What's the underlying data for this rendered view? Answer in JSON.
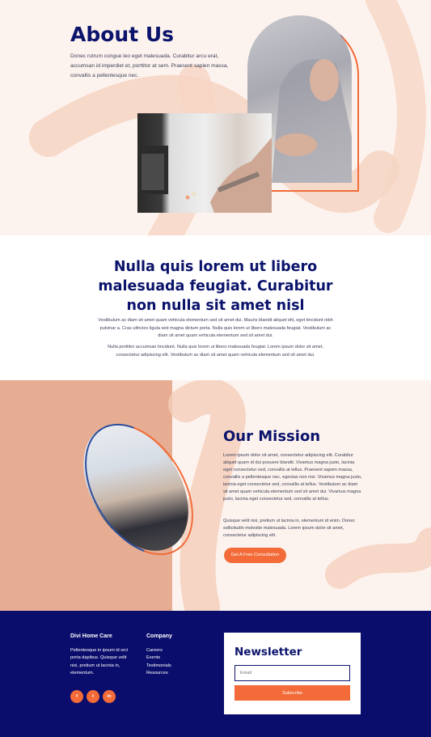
{
  "hero": {
    "title": "About Us",
    "text": "Donec rutrum congue leo eget malesuada. Curabitur arcu erat, accumsan id imperdiet et, porttitor at sem. Praesent sapien massa, convallis a pellentesque nec."
  },
  "intro": {
    "heading": "Nulla quis lorem ut libero malesuada feugiat. Curabitur non nulla sit amet nisl",
    "para1": "Vestibulum ac diam sit amet quam vehicula elementum sed sit amet dui. Mauris blandit aliquet elit, eget tincidunt nibh pulvinar a. Cras ultricies ligula sed magna dictum porta. Nulla quis lorem ut libero malesuada feugiat. Vestibulum ac diam sit amet quam vehicula elementum sed sit amet dui.",
    "para2": "Nulla porttitor accumsan tincidunt. Nulla quis lorem ut libero malesuada feugiat. Lorem ipsum dolor sit amet, consectetur adipiscing elit. Vestibulum ac diam sit amet quam vehicula elementum sed sit amet dui."
  },
  "mission": {
    "title": "Our Mission",
    "para1": "Lorem ipsum dolor sit amet, consectetur adipiscing elit. Curabitur aliquet quam id dui posuere blandit. Vivamus magna justo, lacinia eget consectetur sed, convallis at tellus. Praesent sapien massa, convallis a pellentesque nec, egestas non nisi. Vivamus magna justo, lacinia eget consectetur sed, convallis at tellus. Vestibulum ac diam sit amet quam vehicula elementum sed sit amet dui. Vivamus magna justo, lacinia eget consectetur sed, convallis at tellus.",
    "para2": "Quisque velit nisi, pretium ut lacinia in, elementum id enim. Donec sollicitudin molestie malesuada. Lorem ipsum dolor sit amet, consectetur adipiscing elit.",
    "cta": "Get A Free Consultation"
  },
  "footer": {
    "brand_title": "Divi Home Care",
    "brand_text": "Pellentesque in ipsum id orci porta dapibus. Quisque velit nisi, pretium ut lacinia in, elementum.",
    "company_title": "Company",
    "links": [
      "Careers",
      "Events",
      "Testimonials",
      "Resources"
    ],
    "social": [
      "f",
      "t",
      "in"
    ],
    "newsletter_title": "Newsletter",
    "email_placeholder": "Email",
    "subscribe_label": "Subscribe"
  },
  "colors": {
    "navy": "#0b136b",
    "accent": "#f26b38",
    "peach_bg": "#fdf3ee",
    "clay": "#e6ad93",
    "footer_bg": "#0a0d6b"
  }
}
